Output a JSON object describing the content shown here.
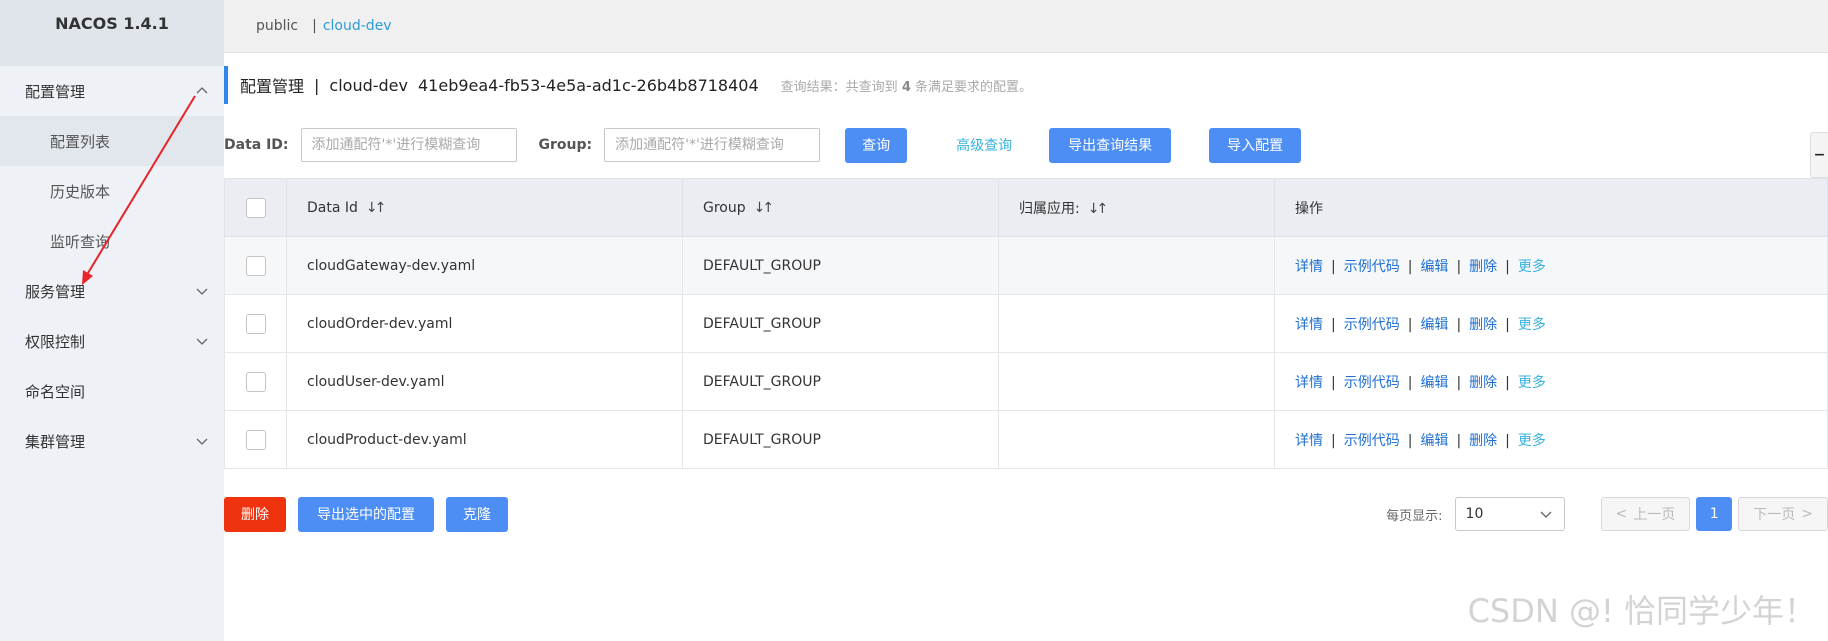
{
  "app": {
    "title": "NACOS 1.4.1"
  },
  "sidebar": {
    "groups": [
      {
        "label": "配置管理",
        "expanded": true,
        "items": [
          {
            "label": "配置列表",
            "active": true
          },
          {
            "label": "历史版本"
          },
          {
            "label": "监听查询"
          }
        ]
      },
      {
        "label": "服务管理",
        "expanded": false
      },
      {
        "label": "权限控制",
        "expanded": false
      },
      {
        "label": "命名空间"
      },
      {
        "label": "集群管理",
        "expanded": false
      }
    ]
  },
  "namespace_bar": {
    "items": [
      "public",
      "cloud-dev"
    ],
    "active": "cloud-dev",
    "separator": "|"
  },
  "header": {
    "title": "配置管理",
    "separator": "|",
    "namespace_name": "cloud-dev",
    "namespace_id": "41eb9ea4-fb53-4e5a-ad1c-26b4b8718404",
    "query_prefix": "查询结果：共查询到",
    "query_count": "4",
    "query_suffix": "条满足要求的配置。"
  },
  "filters": {
    "data_id_label": "Data ID:",
    "data_id_placeholder": "添加通配符'*'进行模糊查询",
    "group_label": "Group:",
    "group_placeholder": "添加通配符'*'进行模糊查询",
    "query_button": "查询",
    "advanced_link": "高级查询",
    "export_button": "导出查询结果",
    "import_button": "导入配置"
  },
  "table": {
    "columns": [
      "Data Id",
      "Group",
      "归属应用:",
      "操作"
    ],
    "rows": [
      {
        "data_id": "cloudGateway-dev.yaml",
        "group": "DEFAULT_GROUP",
        "app": ""
      },
      {
        "data_id": "cloudOrder-dev.yaml",
        "group": "DEFAULT_GROUP",
        "app": ""
      },
      {
        "data_id": "cloudUser-dev.yaml",
        "group": "DEFAULT_GROUP",
        "app": ""
      },
      {
        "data_id": "cloudProduct-dev.yaml",
        "group": "DEFAULT_GROUP",
        "app": ""
      }
    ],
    "operations": {
      "detail": "详情",
      "sample": "示例代码",
      "edit": "编辑",
      "delete": "删除",
      "more": "更多",
      "separator": "|"
    }
  },
  "bottom": {
    "delete_button": "删除",
    "export_selected_button": "导出选中的配置",
    "clone_button": "克隆"
  },
  "pager": {
    "label": "每页显示:",
    "page_size": "10",
    "prev": "上一页",
    "current": "1",
    "next": "下一页"
  },
  "watermark": "CSDN @! 恰同学少年！",
  "colors": {
    "primary": "#4d8ef5",
    "danger": "#f0330f",
    "link": "#1f6fd1",
    "accent": "#38b3e0",
    "annotation_arrow": "#e8232a"
  }
}
